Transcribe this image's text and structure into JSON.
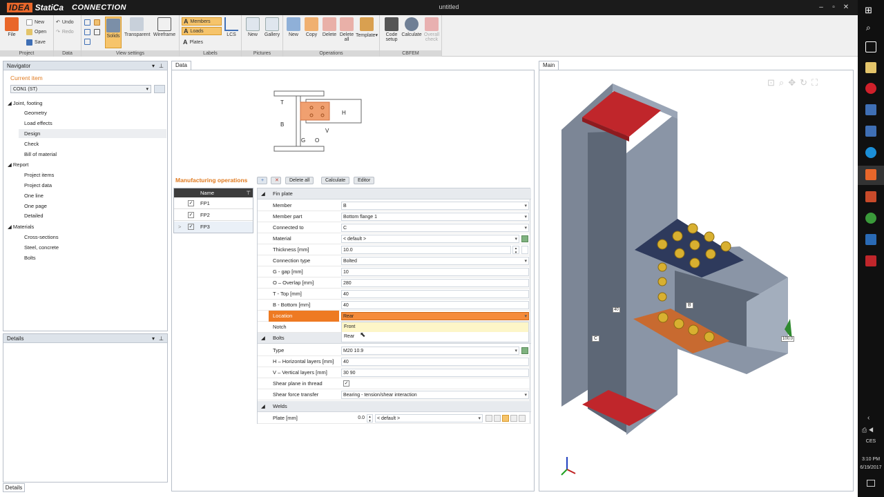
{
  "app": {
    "logo_brand": "IDEA",
    "logo_product": "StatiCa",
    "module": "CONNECTION",
    "window_title": "untitled"
  },
  "ribbon": {
    "groups": [
      "Project",
      "Data",
      "View settings",
      "Labels",
      "Pictures",
      "Operations",
      "CBFEM"
    ],
    "file": "File",
    "new": "New",
    "open": "Open",
    "save": "Save",
    "undo": "Undo",
    "redo": "Redo",
    "solids": "Solids",
    "transparent": "Transparent",
    "wireframe": "Wireframe",
    "members": "Members",
    "loads": "Loads",
    "plates": "Plates",
    "lcs": "LCS",
    "pic_new": "New",
    "gallery": "Gallery",
    "op_new": "New",
    "copy": "Copy",
    "delete": "Delete",
    "delete_all_1": "Delete",
    "delete_all_2": "all",
    "template": "Template",
    "code_setup_1": "Code",
    "code_setup_2": "setup",
    "calculate": "Calculate",
    "overall_1": "Overall",
    "overall_2": "check"
  },
  "navigator": {
    "title": "Navigator",
    "current_item_label": "Current item",
    "current_item": "CON1 (ST)",
    "sections": [
      {
        "label": "Joint, footing",
        "items": [
          "Geometry",
          "Load effects",
          "Design",
          "Check",
          "Bill of material"
        ]
      },
      {
        "label": "Report",
        "items": [
          "Project items",
          "Project data",
          "One line",
          "One page",
          "Detailed"
        ]
      },
      {
        "label": "Materials",
        "items": [
          "Cross-sections",
          "Steel, concrete",
          "Bolts"
        ]
      }
    ]
  },
  "details": {
    "title": "Details",
    "bottom_tab": "Details"
  },
  "data_panel": {
    "tab": "Data",
    "diagram": {
      "t": "T",
      "b": "B",
      "h": "H",
      "v": "V",
      "g": "G",
      "o": "O"
    },
    "mfg_title": "Manufacturing operations",
    "toolbar": {
      "delete_all": "Delete all",
      "calculate": "Calculate",
      "editor": "Editor"
    },
    "ops_header": "Name",
    "ops": [
      "FP1",
      "FP2",
      "FP3"
    ],
    "sections": {
      "fin_plate": "Fin plate",
      "bolts": "Bolts",
      "welds": "Welds"
    },
    "fin_plate_rows": [
      {
        "label": "Member",
        "value": "B"
      },
      {
        "label": "Member part",
        "value": "Bottom flange 1"
      },
      {
        "label": "Connected to",
        "value": "C"
      },
      {
        "label": "Material",
        "value": "< default >"
      },
      {
        "label": "Thickness [mm]",
        "value": "10.0"
      },
      {
        "label": "Connection type",
        "value": "Bolted"
      },
      {
        "label": "G - gap [mm]",
        "value": "10"
      },
      {
        "label": "O – Overlap [mm]",
        "value": "280"
      },
      {
        "label": "T - Top [mm]",
        "value": "40"
      },
      {
        "label": "B - Bottom [mm]",
        "value": "40"
      },
      {
        "label": "Location",
        "value": "Rear"
      },
      {
        "label": "Notch",
        "value": ""
      }
    ],
    "location_options": [
      "Front",
      "Rear"
    ],
    "bolt_rows": [
      {
        "label": "Type",
        "value": "M20 10.9"
      },
      {
        "label": "H – Horizontal layers [mm]",
        "value": "40"
      },
      {
        "label": "V – Vertical layers [mm]",
        "value": "30 90"
      },
      {
        "label": "Shear plane in thread",
        "value": "✓"
      },
      {
        "label": "Shear force transfer",
        "value": "Bearing - tension/shear interaction"
      }
    ],
    "weld_row": {
      "label": "Plate [mm]",
      "num": "0.0",
      "value": "< default >"
    }
  },
  "main_panel": {
    "tab": "Main",
    "label_b": "B",
    "label_c": "C",
    "label_40": "40",
    "label_100": "100.0"
  },
  "taskbar": {
    "time": "3:10 PM",
    "date": "6/19/2017",
    "lang": "CES"
  },
  "colors": {
    "accent": "#e9672a",
    "selected_label": "#ee7a22",
    "mfg_title": "#e07a1f"
  }
}
